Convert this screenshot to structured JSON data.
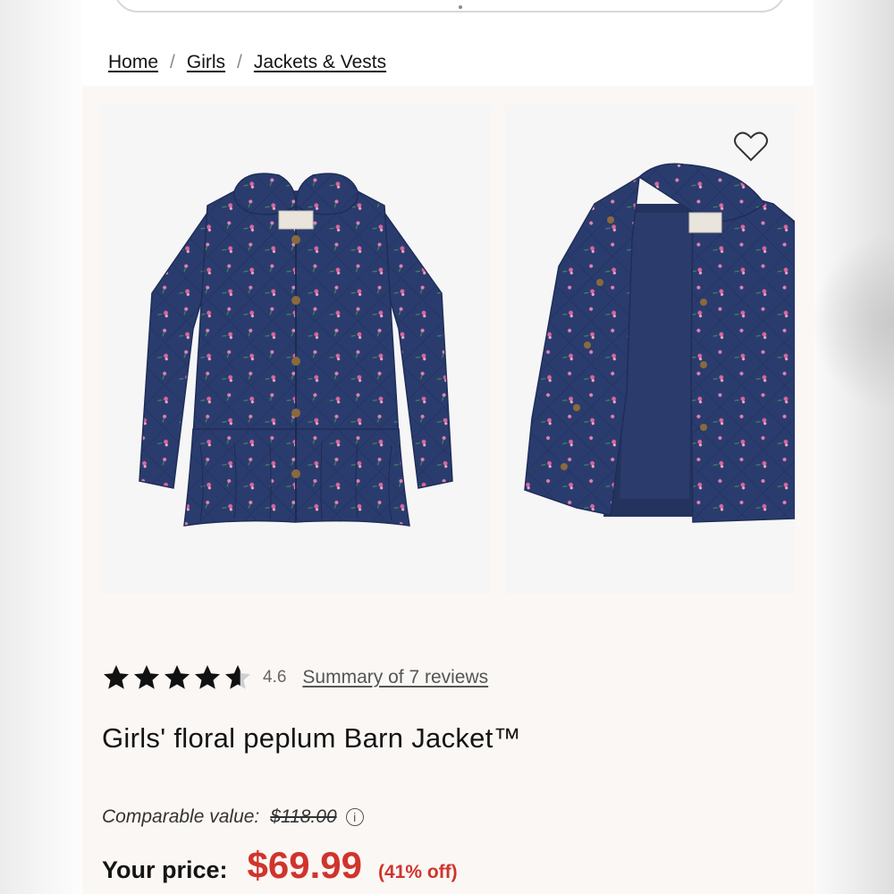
{
  "breadcrumb": {
    "items": [
      "Home",
      "Girls",
      "Jackets & Vests"
    ],
    "separator": "/"
  },
  "gallery": {
    "images": [
      "front-view",
      "open-view"
    ],
    "favorite_icon": "heart-outline-icon"
  },
  "rating": {
    "value": 4.6,
    "value_text": "4.6",
    "stars_max": 5,
    "reviews_link": "Summary of 7 reviews"
  },
  "product": {
    "title": "Girls' floral peplum Barn Jacket™"
  },
  "pricing": {
    "comparable_label": "Comparable value:",
    "comparable_value": "$118.00",
    "info_icon": "info-icon",
    "your_price_label": "Your price:",
    "price": "$69.99",
    "discount": "(41% off)"
  },
  "colors": {
    "price_red": "#d0342c",
    "jacket_navy": "#2a3c6e",
    "background": "#fbf7f4"
  }
}
